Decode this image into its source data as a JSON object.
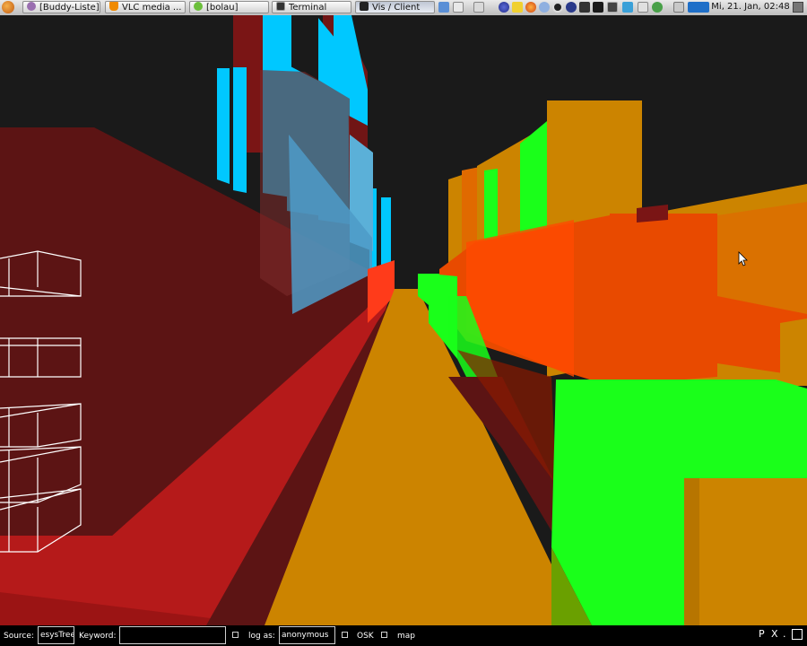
{
  "taskbar": {
    "tabs": [
      {
        "label": "[Buddy-Liste]",
        "icon": "pidgin-icon"
      },
      {
        "label": "VLC media ...",
        "icon": "vlc-cone-icon"
      },
      {
        "label": "[bolau]",
        "icon": "chat-bubble-icon"
      },
      {
        "label": "Terminal",
        "icon": "terminal-icon"
      },
      {
        "label": "Vis / Client",
        "icon": "vis-client-icon"
      }
    ],
    "clock": "Mi, 21. Jan, 02:48"
  },
  "bottombar": {
    "source_label": "Source:",
    "source_value": "esysTree",
    "keyword_label": "Keyword:",
    "keyword_value": "",
    "log_as_label": "log as:",
    "log_as_value": "anonymous",
    "osk_label": "OSK",
    "map_label": "map",
    "p_button": "P",
    "x_button": "X",
    "dot": "."
  },
  "colors": {
    "background": "#1a1a1a",
    "orange": "#cc8400",
    "red": "#cc1a1a",
    "dark_red": "#5c1414",
    "cyan": "#00c8ff",
    "green": "#1aff1a",
    "orange_red": "#e84a00"
  }
}
